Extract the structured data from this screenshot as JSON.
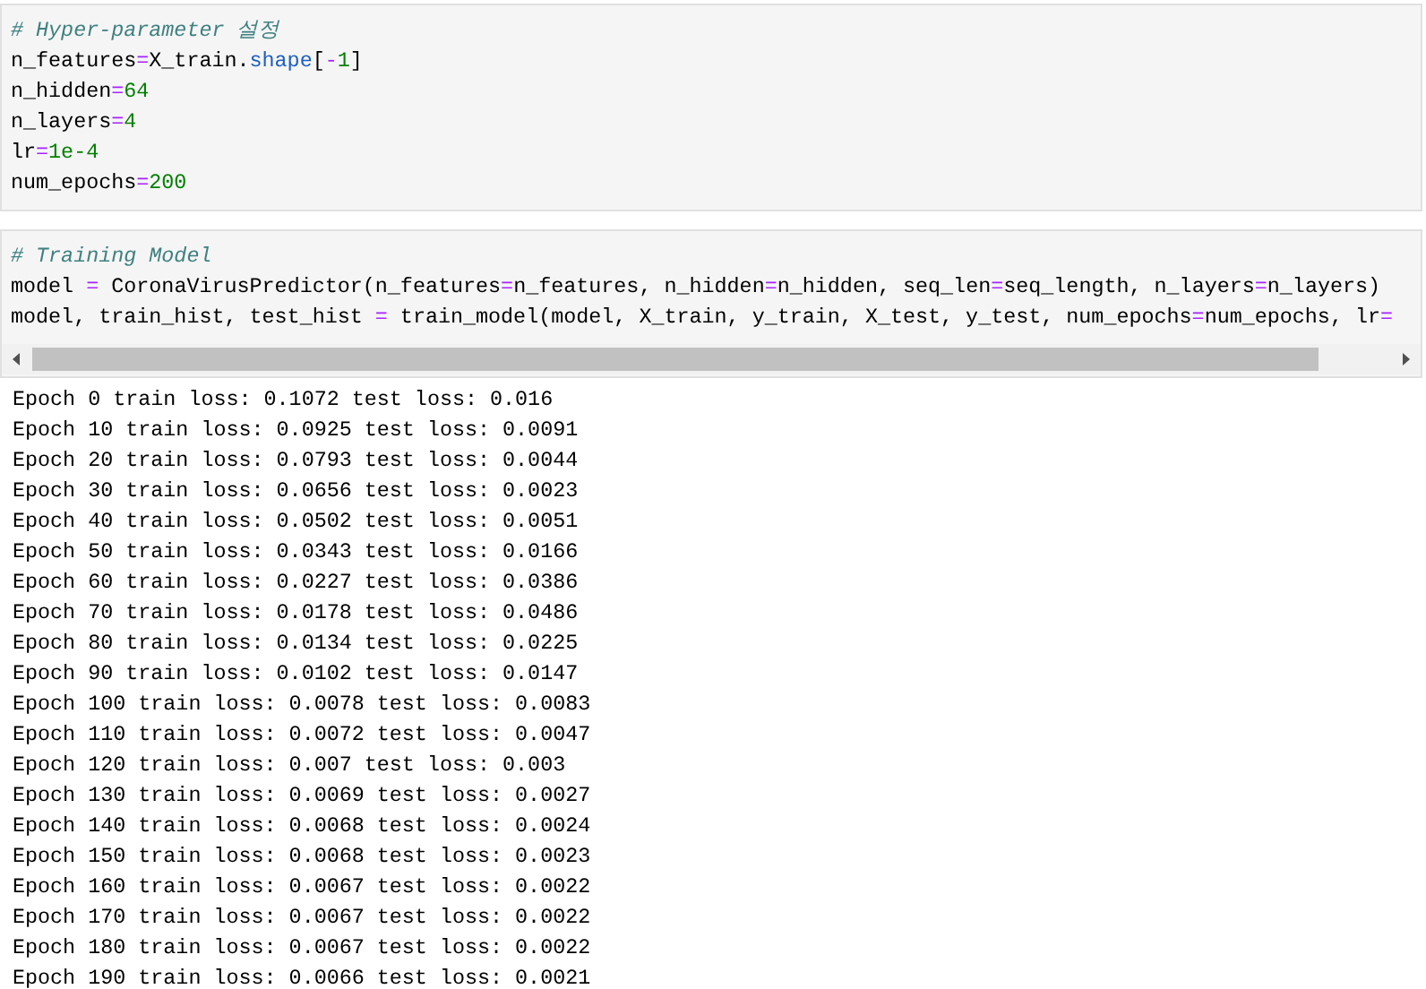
{
  "cells": [
    {
      "lines": [
        [
          {
            "kind": "comment",
            "text": "# Hyper-parameter 설정"
          }
        ],
        [
          {
            "kind": "name",
            "text": "n_features"
          },
          {
            "kind": "op",
            "text": "="
          },
          {
            "kind": "name",
            "text": "X_train."
          },
          {
            "kind": "attr",
            "text": "shape"
          },
          {
            "kind": "name",
            "text": "["
          },
          {
            "kind": "op",
            "text": "-"
          },
          {
            "kind": "number",
            "text": "1"
          },
          {
            "kind": "name",
            "text": "]"
          }
        ],
        [
          {
            "kind": "name",
            "text": "n_hidden"
          },
          {
            "kind": "op",
            "text": "="
          },
          {
            "kind": "number",
            "text": "64"
          }
        ],
        [
          {
            "kind": "name",
            "text": "n_layers"
          },
          {
            "kind": "op",
            "text": "="
          },
          {
            "kind": "number",
            "text": "4"
          }
        ],
        [
          {
            "kind": "name",
            "text": "lr"
          },
          {
            "kind": "op",
            "text": "="
          },
          {
            "kind": "number",
            "text": "1e-4"
          }
        ],
        [
          {
            "kind": "name",
            "text": "num_epochs"
          },
          {
            "kind": "op",
            "text": "="
          },
          {
            "kind": "number",
            "text": "200"
          }
        ]
      ],
      "scrollbar": false
    },
    {
      "lines": [
        [
          {
            "kind": "comment",
            "text": "# Training Model"
          }
        ],
        [
          {
            "kind": "name",
            "text": "model "
          },
          {
            "kind": "op",
            "text": "="
          },
          {
            "kind": "name",
            "text": " CoronaVirusPredictor(n_features"
          },
          {
            "kind": "op",
            "text": "="
          },
          {
            "kind": "name",
            "text": "n_features, n_hidden"
          },
          {
            "kind": "op",
            "text": "="
          },
          {
            "kind": "name",
            "text": "n_hidden, seq_len"
          },
          {
            "kind": "op",
            "text": "="
          },
          {
            "kind": "name",
            "text": "seq_length, n_layers"
          },
          {
            "kind": "op",
            "text": "="
          },
          {
            "kind": "name",
            "text": "n_layers)"
          }
        ],
        [
          {
            "kind": "name",
            "text": "model, train_hist, test_hist "
          },
          {
            "kind": "op",
            "text": "="
          },
          {
            "kind": "name",
            "text": " train_model(model, X_train, y_train, X_test, y_test, num_epochs"
          },
          {
            "kind": "op",
            "text": "="
          },
          {
            "kind": "name",
            "text": "num_epochs, lr"
          },
          {
            "kind": "op",
            "text": "="
          }
        ]
      ],
      "scrollbar": true
    }
  ],
  "output": [
    "Epoch 0 train loss: 0.1072 test loss: 0.016",
    "Epoch 10 train loss: 0.0925 test loss: 0.0091",
    "Epoch 20 train loss: 0.0793 test loss: 0.0044",
    "Epoch 30 train loss: 0.0656 test loss: 0.0023",
    "Epoch 40 train loss: 0.0502 test loss: 0.0051",
    "Epoch 50 train loss: 0.0343 test loss: 0.0166",
    "Epoch 60 train loss: 0.0227 test loss: 0.0386",
    "Epoch 70 train loss: 0.0178 test loss: 0.0486",
    "Epoch 80 train loss: 0.0134 test loss: 0.0225",
    "Epoch 90 train loss: 0.0102 test loss: 0.0147",
    "Epoch 100 train loss: 0.0078 test loss: 0.0083",
    "Epoch 110 train loss: 0.0072 test loss: 0.0047",
    "Epoch 120 train loss: 0.007 test loss: 0.003",
    "Epoch 130 train loss: 0.0069 test loss: 0.0027",
    "Epoch 140 train loss: 0.0068 test loss: 0.0024",
    "Epoch 150 train loss: 0.0068 test loss: 0.0023",
    "Epoch 160 train loss: 0.0067 test loss: 0.0022",
    "Epoch 170 train loss: 0.0067 test loss: 0.0022",
    "Epoch 180 train loss: 0.0067 test loss: 0.0022",
    "Epoch 190 train loss: 0.0066 test loss: 0.0021"
  ]
}
